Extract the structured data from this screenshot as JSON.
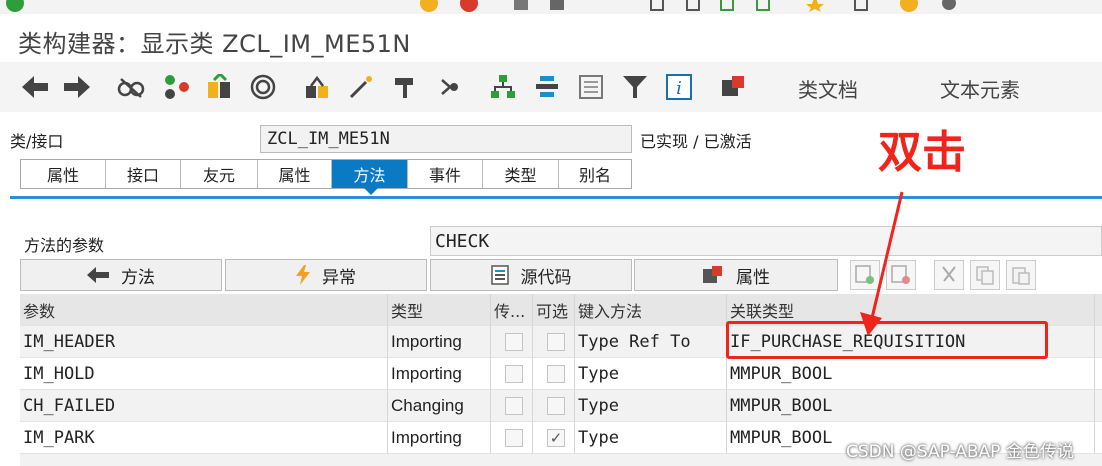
{
  "window": {
    "title": "类构建器：显示类 ZCL_IM_ME51N"
  },
  "toolbar": {
    "icons": [
      "back-arrow-icon",
      "forward-arrow-icon",
      "glasses-icon",
      "activate-icon",
      "object-list-icon",
      "where-used-icon",
      "hierarchy-icon",
      "magic-wand-icon",
      "hammer-icon",
      "navigate-icon",
      "org-chart-icon",
      "stack-icon",
      "document-icon",
      "filter-icon",
      "info-icon",
      "settings-icon"
    ],
    "class_doc_label": "类文档",
    "text_elements_label": "文本元素"
  },
  "class_row": {
    "label": "类/接口",
    "value": "ZCL_IM_ME51N",
    "status": "已实现 / 已激活"
  },
  "tabs": [
    {
      "label": "属性",
      "active": false
    },
    {
      "label": "接口",
      "active": false
    },
    {
      "label": "友元",
      "active": false
    },
    {
      "label": "属性",
      "active": false
    },
    {
      "label": "方法",
      "active": true
    },
    {
      "label": "事件",
      "active": false
    },
    {
      "label": "类型",
      "active": false
    },
    {
      "label": "别名",
      "active": false
    }
  ],
  "method_row": {
    "label": "方法的参数",
    "value": "CHECK"
  },
  "nav_buttons": {
    "method": "方法",
    "exceptions": "异常",
    "source_code": "源代码",
    "attributes": "属性"
  },
  "table": {
    "headers": [
      "参数",
      "类型",
      "传...",
      "可选",
      "键入方法",
      "关联类型"
    ],
    "rows": [
      {
        "param": "IM_HEADER",
        "kind": "Importing",
        "pass_value": false,
        "optional": false,
        "typing": "Type Ref To",
        "assoc": "IF_PURCHASE_REQUISITION"
      },
      {
        "param": "IM_HOLD",
        "kind": "Importing",
        "pass_value": false,
        "optional": false,
        "typing": "Type",
        "assoc": "MMPUR_BOOL"
      },
      {
        "param": "CH_FAILED",
        "kind": "Changing",
        "pass_value": false,
        "optional": false,
        "typing": "Type",
        "assoc": "MMPUR_BOOL"
      },
      {
        "param": "IM_PARK",
        "kind": "Importing",
        "pass_value": false,
        "optional": true,
        "typing": "Type",
        "assoc": "MMPUR_BOOL"
      }
    ]
  },
  "annotation": {
    "text": "双击",
    "color": "#f0241b"
  },
  "watermark": "CSDN @SAP-ABAP 金色传说",
  "colors": {
    "active_tab": "#0a7ac4",
    "accent_line": "#2a8fd6"
  }
}
